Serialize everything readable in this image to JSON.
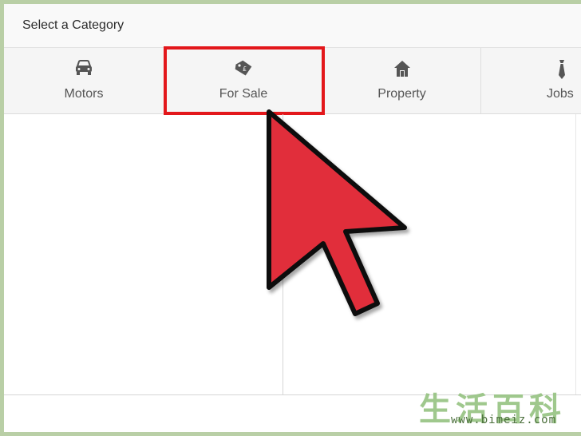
{
  "header": {
    "title": "Select a Category"
  },
  "tabs": [
    {
      "label": "Motors",
      "icon": "car-icon"
    },
    {
      "label": "For Sale",
      "icon": "price-tag-icon"
    },
    {
      "label": "Property",
      "icon": "house-icon"
    },
    {
      "label": "Jobs",
      "icon": "tie-icon"
    }
  ],
  "highlighted_tab": "For Sale",
  "colors": {
    "highlight": "#e3171b",
    "cursor": "#e12d3a"
  },
  "watermark": {
    "chars": "生活百科",
    "url": "www.bimeiz.com"
  }
}
